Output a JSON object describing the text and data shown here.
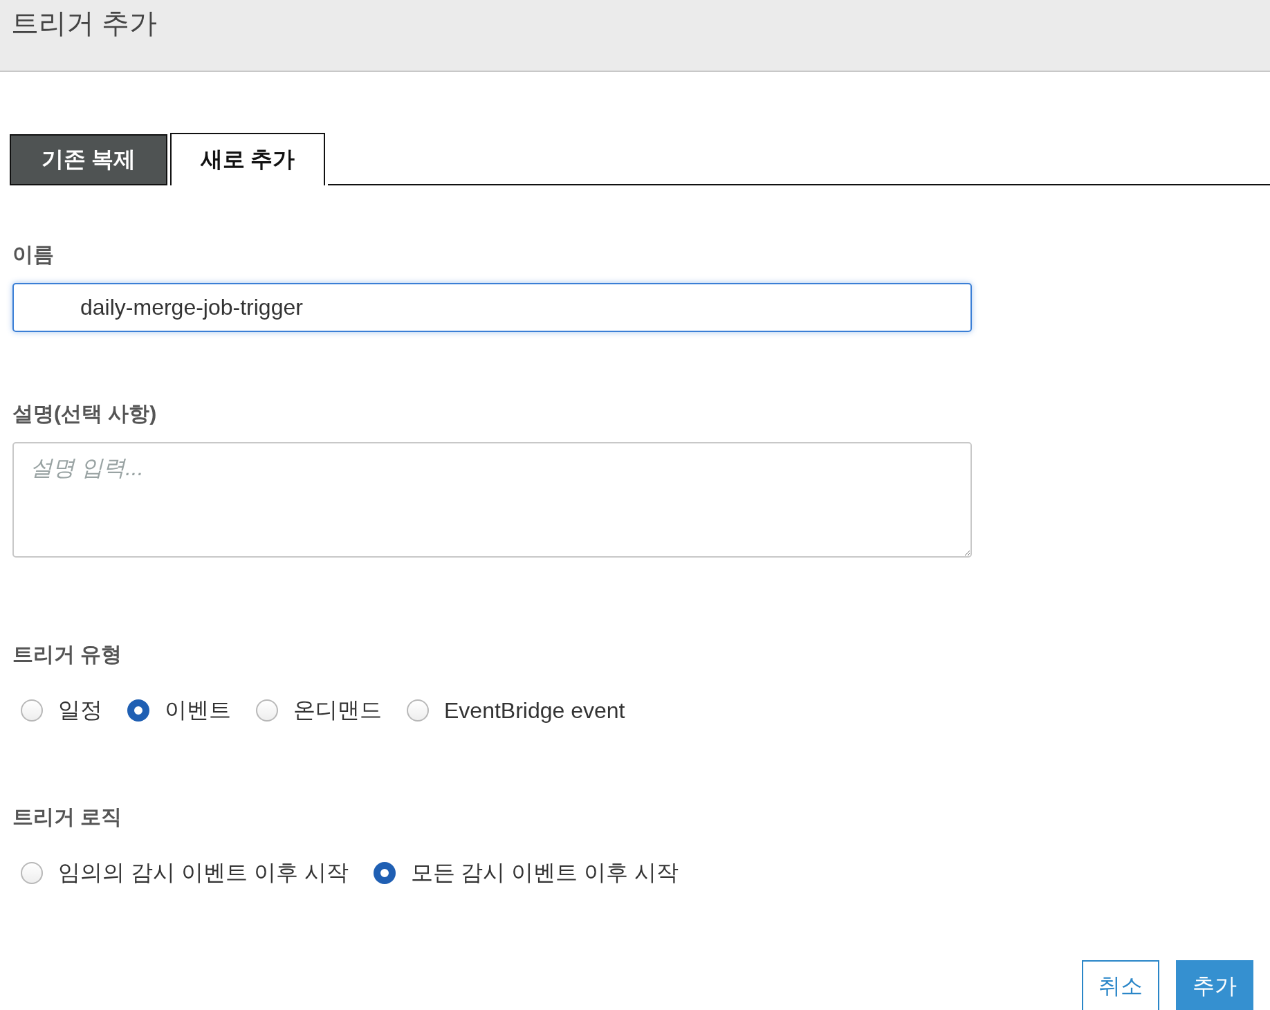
{
  "header": {
    "title": "트리거 추가"
  },
  "tabs": [
    {
      "label": "기존 복제",
      "selected": false
    },
    {
      "label": "새로 추가",
      "selected": true
    }
  ],
  "name_field": {
    "label": "이름",
    "value": "daily-merge-job-trigger",
    "focused": true
  },
  "description_field": {
    "label": "설명(선택 사항)",
    "placeholder": "설명 입력..."
  },
  "trigger_type": {
    "label": "트리거 유형",
    "options": [
      {
        "label": "일정",
        "selected": false
      },
      {
        "label": "이벤트",
        "selected": true
      },
      {
        "label": "온디맨드",
        "selected": false
      },
      {
        "label": "EventBridge event",
        "selected": false
      }
    ]
  },
  "trigger_logic": {
    "label": "트리거 로직",
    "options": [
      {
        "label": "임의의 감시 이벤트 이후 시작",
        "selected": false
      },
      {
        "label": "모든 감시 이벤트 이후 시작",
        "selected": true
      }
    ]
  },
  "buttons": [
    {
      "label": "취소",
      "kind": "secondary"
    },
    {
      "label": "추가",
      "kind": "primary"
    }
  ]
}
